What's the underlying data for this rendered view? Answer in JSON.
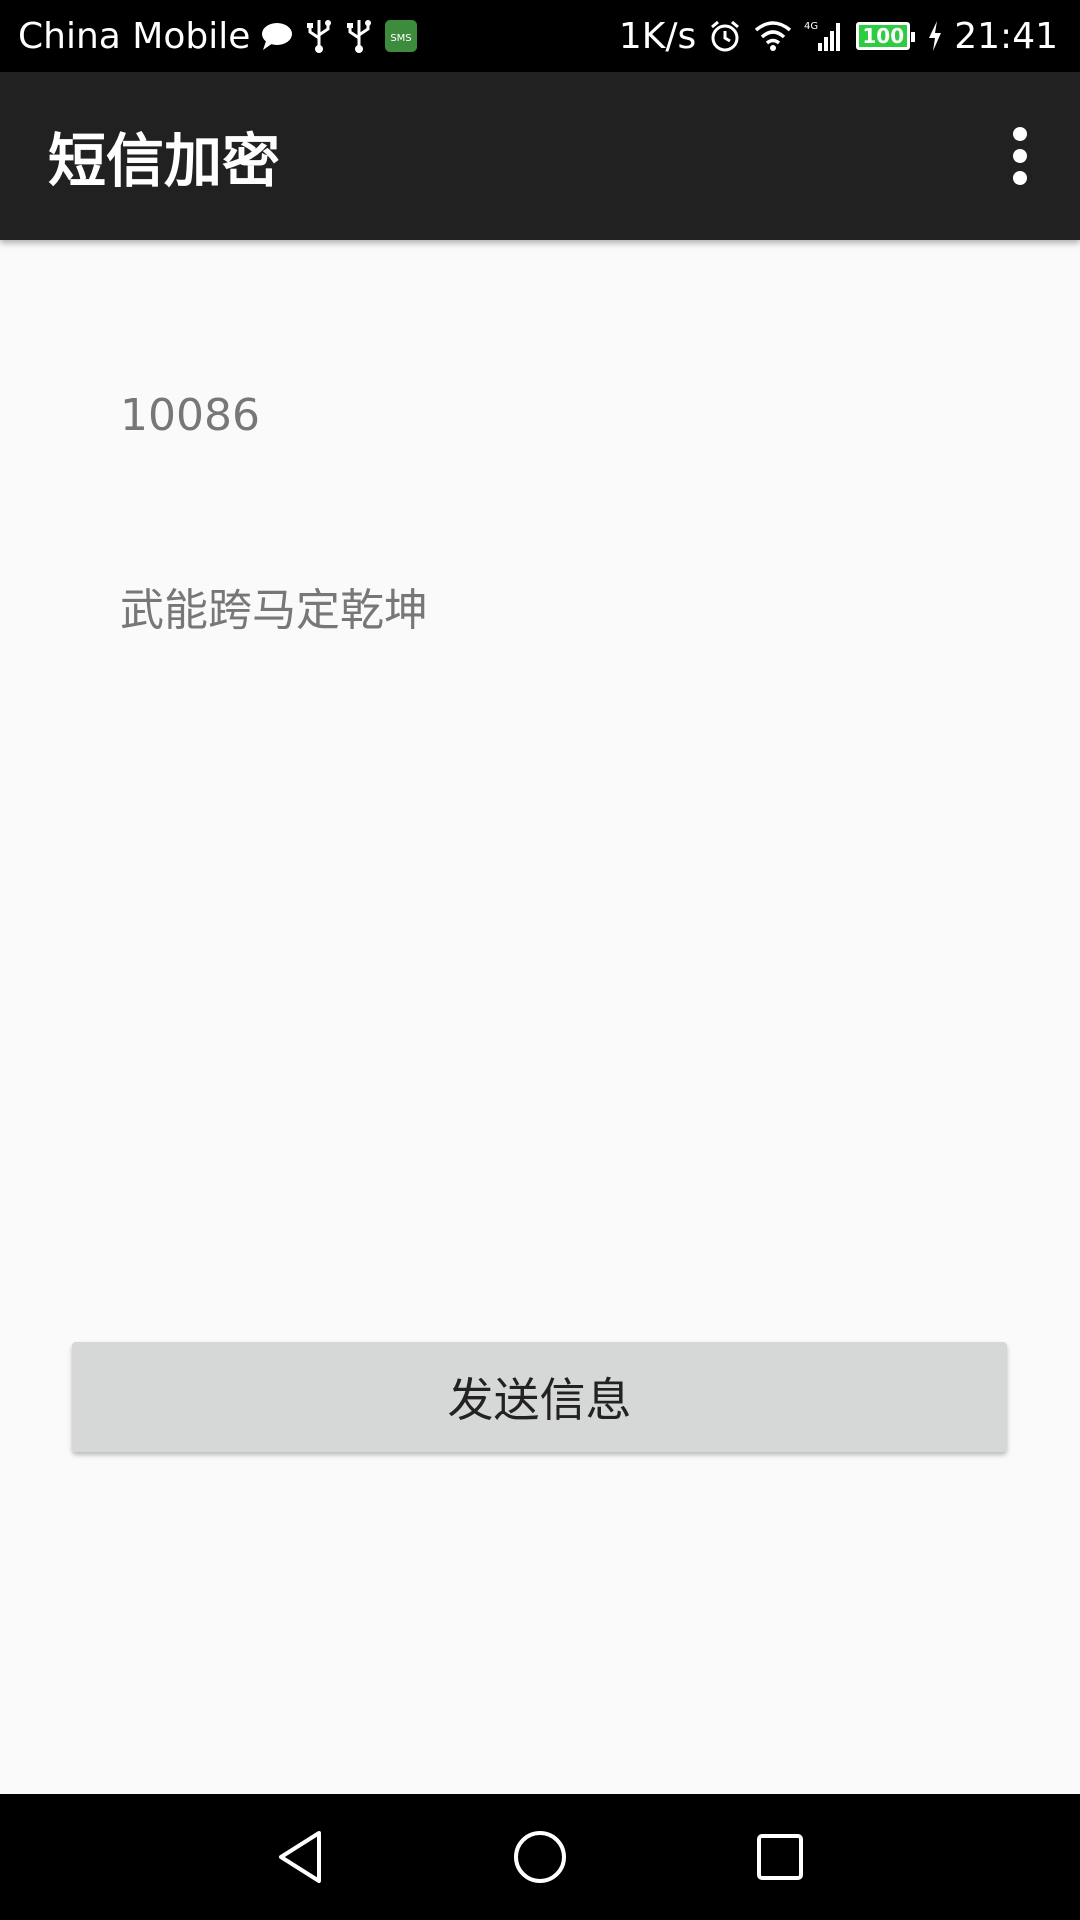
{
  "status_bar": {
    "carrier": "China Mobile",
    "net_speed": "1K/s",
    "network_type": "4G",
    "battery_level": "100",
    "time": "21:41",
    "icons": [
      "chat-bubble-icon",
      "usb-icon",
      "usb-icon",
      "sms-icon",
      "alarm-icon",
      "wifi-icon",
      "signal-icon",
      "battery-icon",
      "charging-icon"
    ]
  },
  "app_bar": {
    "title": "短信加密",
    "menu_icon": "more-vert-icon"
  },
  "form": {
    "phone_value": "10086",
    "message_value": "武能跨马定乾坤",
    "send_label": "发送信息"
  },
  "nav_bar": {
    "icons": [
      "back-icon",
      "home-icon",
      "recent-apps-icon"
    ]
  },
  "colors": {
    "app_bar_bg": "#212121",
    "content_bg": "#fafafa",
    "button_bg": "#d6d7d7",
    "battery_fill": "#2ecc40"
  }
}
